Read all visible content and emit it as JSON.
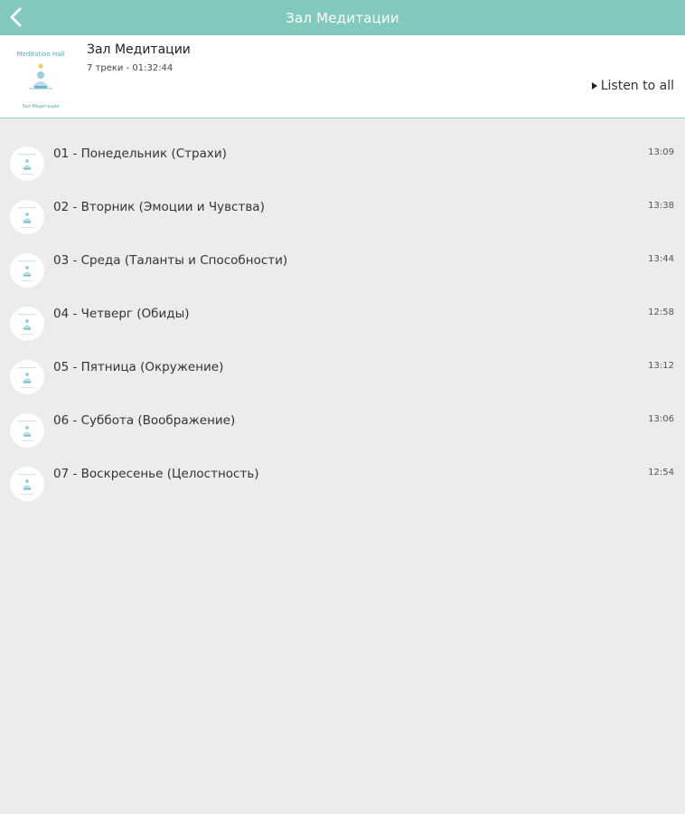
{
  "header": {
    "title": "Зал Медитации",
    "back_icon": "chevron-left-icon"
  },
  "album": {
    "title": "Зал Медитации",
    "meta": "7 треки - 01:32:44",
    "cover_text_top": "Meditation Hall",
    "cover_text_bottom": "Зал Медитации",
    "listen_all": "Listen to all"
  },
  "tracks": [
    {
      "title": "01 - Понедельник (Страхи)",
      "duration": "13:09"
    },
    {
      "title": "02 - Вторник (Эмоции и Чувства)",
      "duration": "13:38"
    },
    {
      "title": "03 - Среда (Таланты и Способности)",
      "duration": "13:44"
    },
    {
      "title": "04 - Четверг (Обиды)",
      "duration": "12:58"
    },
    {
      "title": "05 - Пятница (Окружение)",
      "duration": "13:12"
    },
    {
      "title": "06 - Суббота (Воображение)",
      "duration": "13:06"
    },
    {
      "title": "07 - Воскресенье (Целостность)",
      "duration": "12:54"
    }
  ],
  "colors": {
    "accent": "#84c9bd",
    "background": "#ececec"
  }
}
